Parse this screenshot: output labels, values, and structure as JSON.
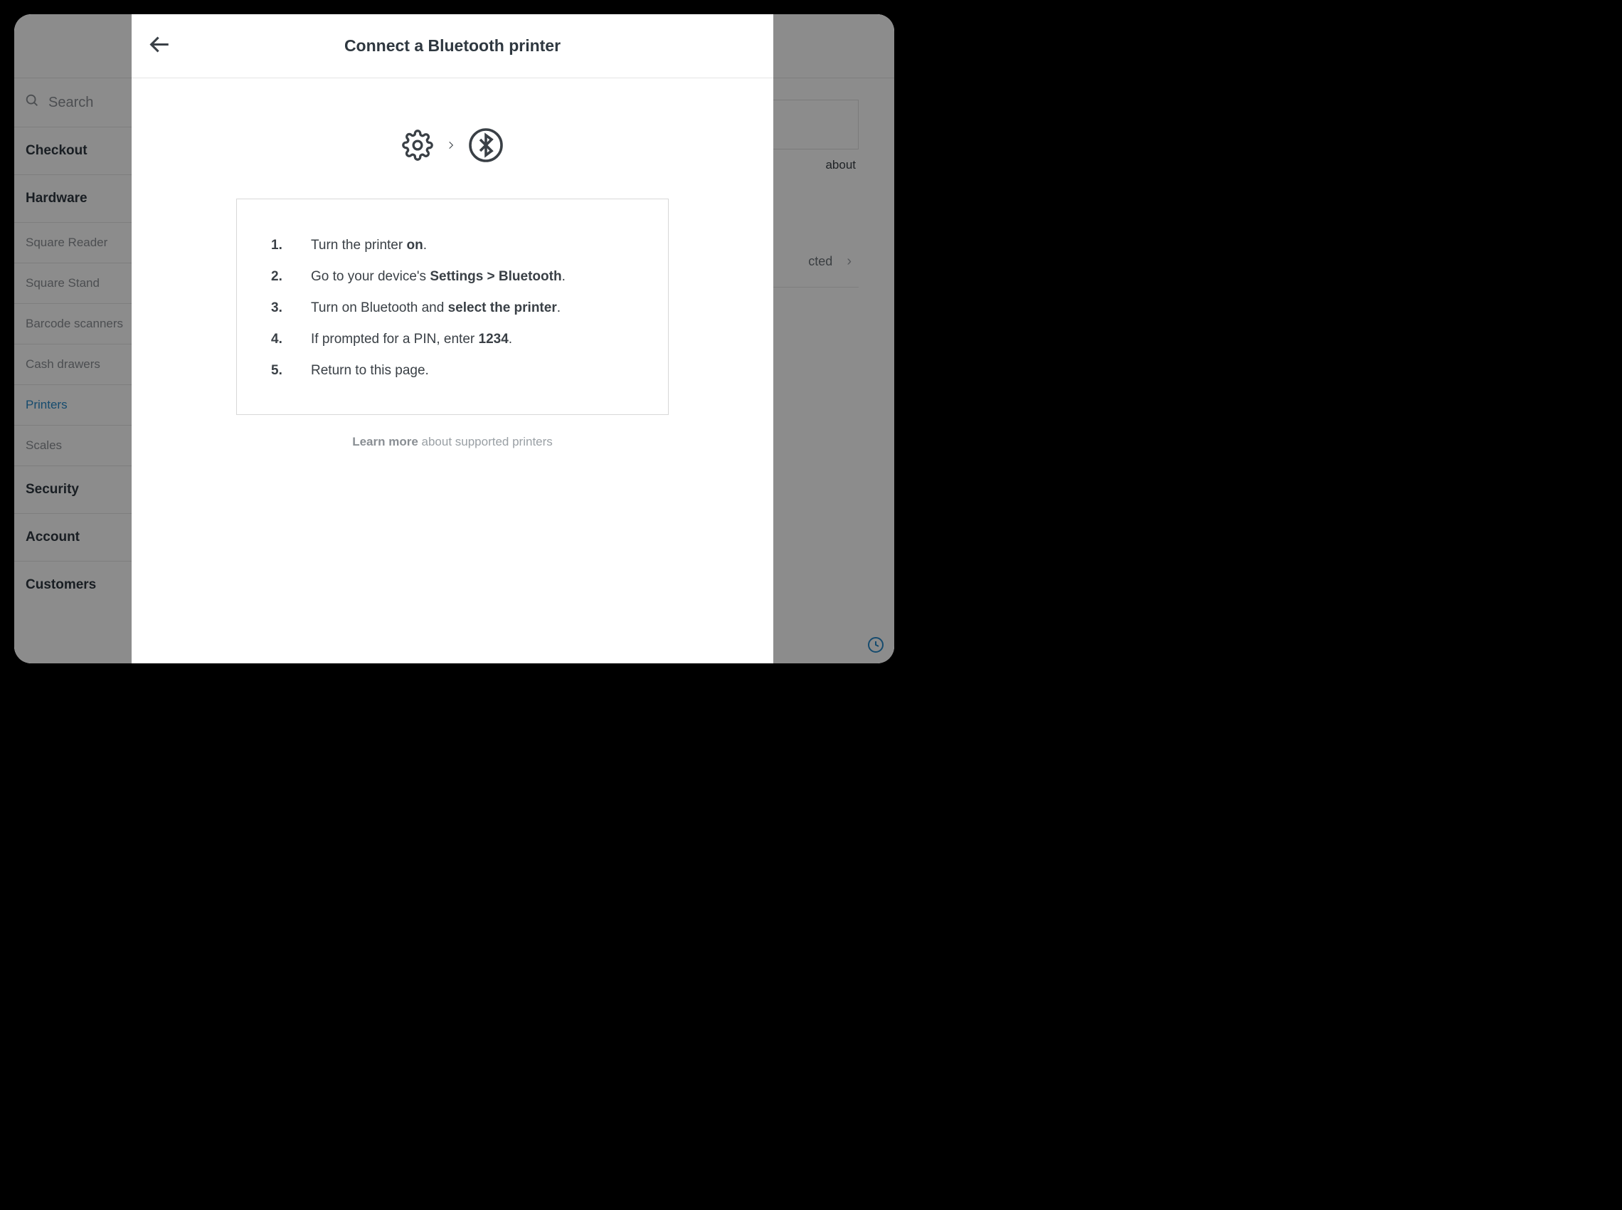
{
  "sidebar": {
    "search_placeholder": "Search",
    "sections": {
      "checkout": "Checkout",
      "hardware": "Hardware",
      "security": "Security",
      "account": "Account",
      "customers": "Customers"
    },
    "hardware_subs": {
      "reader": "Square Reader",
      "stand": "Square Stand",
      "barcode": "Barcode scanners",
      "cash": "Cash drawers",
      "printers": "Printers",
      "scales": "Scales"
    }
  },
  "main": {
    "about_fragment": "about",
    "row_status": "cted",
    "chevron": "›"
  },
  "modal": {
    "title": "Connect a Bluetooth printer",
    "steps": [
      {
        "num": "1.",
        "pre": "Turn the printer ",
        "bold": "on",
        "post": "."
      },
      {
        "num": "2.",
        "pre": "Go to your device's ",
        "bold": "Settings > Bluetooth",
        "post": "."
      },
      {
        "num": "3.",
        "pre": "Turn on Bluetooth and ",
        "bold": "select the printer",
        "post": "."
      },
      {
        "num": "4.",
        "pre": "If prompted for a PIN, enter ",
        "bold": "1234",
        "post": "."
      },
      {
        "num": "5.",
        "pre": "Return to this page.",
        "bold": "",
        "post": ""
      }
    ],
    "learn_more": "Learn more",
    "learn_tail": " about supported printers"
  }
}
